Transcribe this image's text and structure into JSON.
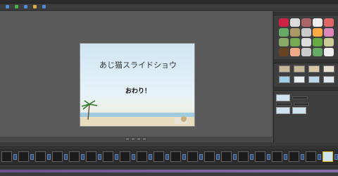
{
  "window": {
    "title": ""
  },
  "toolbar": {
    "buttons": [
      {
        "label": "",
        "icon": "film-icon",
        "color": "#4a8ad8"
      },
      {
        "label": "",
        "icon": "add-icon",
        "color": "#4ab04a"
      },
      {
        "label": "",
        "icon": "image-icon",
        "color": "#4a8ad8"
      },
      {
        "label": "",
        "icon": "text-icon",
        "color": "#d8a84a"
      },
      {
        "label": "",
        "icon": "share-icon",
        "color": "#4a8ad8"
      }
    ]
  },
  "slide": {
    "title": "あじ猫スライドショウ",
    "subtitle": "おわり！"
  },
  "right_panel": {
    "header": "",
    "tabs": [
      "",
      ""
    ],
    "sticker_colors": [
      "#c24",
      "#ddd",
      "#a66",
      "#eee",
      "#d66",
      "#6a6",
      "#a96",
      "#ccc",
      "#fa4",
      "#d8b",
      "#8a6",
      "#7a5",
      "#ddd",
      "#6a4",
      "#cc9",
      "#642",
      "#ea8",
      "#ccc",
      "#6a6",
      "#eee"
    ],
    "frame_colors": [
      "#c8b89a",
      "#c8b89a",
      "#d8c8a8",
      "#e8e0d0",
      "#9fcfe8",
      "#e6eef2",
      "#bcd8ea",
      "#dfe8ee"
    ]
  },
  "storyboard": {
    "label": "",
    "options": [
      "",
      ""
    ]
  }
}
